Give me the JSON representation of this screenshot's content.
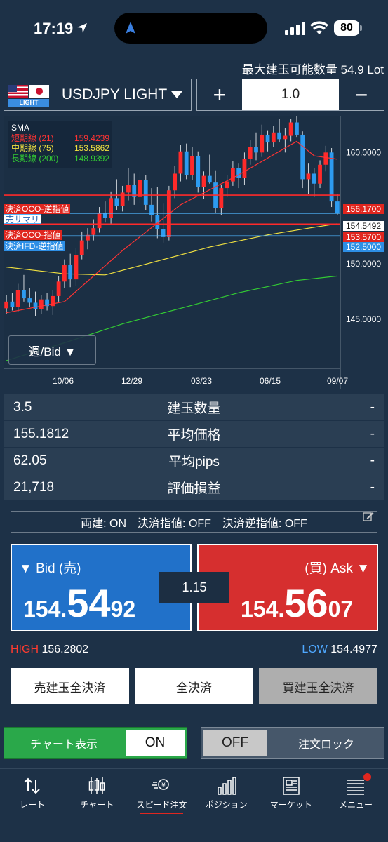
{
  "status_bar": {
    "time": "17:19",
    "battery": "80"
  },
  "header": {
    "max_qty": "最大建玉可能数量 54.9 Lot"
  },
  "symbol": {
    "name": "USDJPY LIGHT",
    "tag": "LIGHT"
  },
  "quantity": {
    "plus": "+",
    "value": "1.0",
    "minus": "−"
  },
  "chart": {
    "sma": {
      "title": "SMA",
      "rows": [
        {
          "label": "短期線 (21)",
          "value": "159.4239",
          "color": "#ff3333"
        },
        {
          "label": "中期線 (75)",
          "value": "153.5862",
          "color": "#f0e040"
        },
        {
          "label": "長期線 (200)",
          "value": "148.9392",
          "color": "#33cc33"
        }
      ]
    },
    "timeframe_button": "週/Bid ▼",
    "order_labels": {
      "oco_stop": "決済OCO-逆指値",
      "sell_summary": "売サマリ",
      "oco_limit": "決済OCO-指値",
      "ifd_stop": "決済IFD-逆指値"
    },
    "price_tags": {
      "oco_stop": "156.1700",
      "current": "154.5492",
      "oco_limit": "153.5700",
      "ifd_stop": "152.5000"
    }
  },
  "chart_data": {
    "type": "candlestick",
    "y_ticks": [
      "160.0000",
      "155.0000",
      "150.0000",
      "145.0000"
    ],
    "x_ticks": [
      "10/06",
      "12/29",
      "03/23",
      "06/15",
      "09/07"
    ],
    "ylim": [
      140.6,
      163.3
    ],
    "candles": [
      {
        "o": 146.0,
        "h": 147.2,
        "l": 145.5,
        "c": 146.6
      },
      {
        "o": 146.6,
        "h": 147.4,
        "l": 145.8,
        "c": 146.1
      },
      {
        "o": 146.1,
        "h": 148.2,
        "l": 145.7,
        "c": 147.6
      },
      {
        "o": 147.6,
        "h": 149.0,
        "l": 146.6,
        "c": 146.9
      },
      {
        "o": 146.9,
        "h": 147.8,
        "l": 146.1,
        "c": 146.5
      },
      {
        "o": 146.5,
        "h": 147.5,
        "l": 145.3,
        "c": 145.9
      },
      {
        "o": 145.9,
        "h": 147.2,
        "l": 145.5,
        "c": 146.8
      },
      {
        "o": 146.8,
        "h": 147.4,
        "l": 145.8,
        "c": 146.2
      },
      {
        "o": 146.2,
        "h": 147.6,
        "l": 145.4,
        "c": 147.1
      },
      {
        "o": 147.1,
        "h": 148.9,
        "l": 146.6,
        "c": 148.4
      },
      {
        "o": 148.4,
        "h": 150.4,
        "l": 147.8,
        "c": 149.9
      },
      {
        "o": 149.9,
        "h": 150.9,
        "l": 147.9,
        "c": 148.6
      },
      {
        "o": 148.6,
        "h": 151.4,
        "l": 148.0,
        "c": 150.8
      },
      {
        "o": 150.8,
        "h": 152.9,
        "l": 150.4,
        "c": 152.1
      },
      {
        "o": 152.1,
        "h": 153.2,
        "l": 151.3,
        "c": 152.6
      },
      {
        "o": 152.6,
        "h": 154.0,
        "l": 152.1,
        "c": 153.2
      },
      {
        "o": 153.2,
        "h": 155.1,
        "l": 152.8,
        "c": 154.6
      },
      {
        "o": 154.6,
        "h": 155.6,
        "l": 153.7,
        "c": 154.1
      },
      {
        "o": 154.1,
        "h": 156.5,
        "l": 153.5,
        "c": 155.9
      },
      {
        "o": 155.9,
        "h": 157.6,
        "l": 154.8,
        "c": 155.2
      },
      {
        "o": 155.2,
        "h": 157.0,
        "l": 154.7,
        "c": 156.4
      },
      {
        "o": 156.4,
        "h": 158.6,
        "l": 155.7,
        "c": 157.1
      },
      {
        "o": 157.1,
        "h": 158.1,
        "l": 155.3,
        "c": 156.0
      },
      {
        "o": 156.0,
        "h": 158.3,
        "l": 155.4,
        "c": 157.5
      },
      {
        "o": 157.5,
        "h": 158.0,
        "l": 154.8,
        "c": 155.3
      },
      {
        "o": 155.3,
        "h": 156.8,
        "l": 153.8,
        "c": 154.4
      },
      {
        "o": 154.4,
        "h": 156.9,
        "l": 152.3,
        "c": 153.1
      },
      {
        "o": 153.1,
        "h": 155.4,
        "l": 151.9,
        "c": 152.4
      },
      {
        "o": 152.4,
        "h": 157.0,
        "l": 152.1,
        "c": 156.6
      },
      {
        "o": 156.6,
        "h": 158.8,
        "l": 155.9,
        "c": 158.1
      },
      {
        "o": 158.1,
        "h": 160.7,
        "l": 157.4,
        "c": 160.1
      },
      {
        "o": 160.1,
        "h": 160.8,
        "l": 157.6,
        "c": 158.0
      },
      {
        "o": 158.0,
        "h": 160.5,
        "l": 157.5,
        "c": 159.7
      },
      {
        "o": 159.7,
        "h": 160.1,
        "l": 156.4,
        "c": 156.9
      },
      {
        "o": 156.9,
        "h": 158.3,
        "l": 155.8,
        "c": 157.9
      },
      {
        "o": 157.9,
        "h": 159.8,
        "l": 157.2,
        "c": 157.3
      },
      {
        "o": 157.3,
        "h": 158.4,
        "l": 154.6,
        "c": 155.0
      },
      {
        "o": 155.0,
        "h": 157.1,
        "l": 154.4,
        "c": 156.8
      },
      {
        "o": 156.8,
        "h": 158.0,
        "l": 156.0,
        "c": 157.4
      },
      {
        "o": 157.4,
        "h": 159.2,
        "l": 157.0,
        "c": 158.6
      },
      {
        "o": 158.6,
        "h": 159.0,
        "l": 156.8,
        "c": 157.7
      },
      {
        "o": 157.7,
        "h": 160.0,
        "l": 157.1,
        "c": 159.4
      },
      {
        "o": 159.4,
        "h": 161.1,
        "l": 158.9,
        "c": 160.5
      },
      {
        "o": 160.5,
        "h": 161.8,
        "l": 159.3,
        "c": 160.0
      },
      {
        "o": 160.0,
        "h": 162.5,
        "l": 159.6,
        "c": 161.6
      },
      {
        "o": 161.6,
        "h": 162.0,
        "l": 160.1,
        "c": 160.9
      },
      {
        "o": 160.9,
        "h": 162.4,
        "l": 160.5,
        "c": 161.8
      },
      {
        "o": 161.8,
        "h": 163.0,
        "l": 160.9,
        "c": 161.2
      },
      {
        "o": 161.2,
        "h": 162.2,
        "l": 160.0,
        "c": 161.5
      },
      {
        "o": 161.5,
        "h": 163.0,
        "l": 161.0,
        "c": 162.7
      },
      {
        "o": 162.7,
        "h": 163.3,
        "l": 161.4,
        "c": 161.6
      },
      {
        "o": 161.6,
        "h": 161.9,
        "l": 156.8,
        "c": 157.6
      },
      {
        "o": 157.6,
        "h": 159.0,
        "l": 156.3,
        "c": 158.1
      },
      {
        "o": 158.1,
        "h": 158.6,
        "l": 156.0,
        "c": 157.2
      },
      {
        "o": 157.2,
        "h": 159.3,
        "l": 156.8,
        "c": 158.9
      },
      {
        "o": 158.9,
        "h": 160.6,
        "l": 158.3,
        "c": 160.0
      },
      {
        "o": 160.0,
        "h": 160.4,
        "l": 155.1,
        "c": 155.6
      },
      {
        "o": 155.6,
        "h": 156.3,
        "l": 154.4,
        "c": 154.5
      }
    ],
    "sma_short": [
      [
        0,
        145.6
      ],
      [
        10,
        146.6
      ],
      [
        20,
        151.2
      ],
      [
        30,
        155.3
      ],
      [
        40,
        158.0
      ],
      [
        50,
        161.0
      ],
      [
        53,
        159.7
      ],
      [
        57,
        159.4
      ]
    ],
    "sma_mid": [
      [
        0,
        149.7
      ],
      [
        10,
        149.1
      ],
      [
        17,
        149.0
      ],
      [
        25,
        150.1
      ],
      [
        35,
        151.5
      ],
      [
        45,
        152.6
      ],
      [
        52,
        153.2
      ],
      [
        57,
        153.6
      ]
    ],
    "sma_long": [
      [
        0,
        141.3
      ],
      [
        10,
        142.9
      ],
      [
        20,
        144.6
      ],
      [
        30,
        146.0
      ],
      [
        40,
        147.4
      ],
      [
        50,
        148.5
      ],
      [
        57,
        148.9
      ]
    ],
    "hlines": [
      {
        "name": "決済OCO-逆指値",
        "value": 156.17,
        "color": "#ff2a2a"
      },
      {
        "name": "売サマリ",
        "value": 154.5492,
        "color": "#4fb7ff"
      },
      {
        "name": "決済OCO-指値",
        "value": 153.57,
        "color": "#ff2a2a"
      },
      {
        "name": "決済IFD-逆指値",
        "value": 152.5,
        "color": "#4fb7ff"
      }
    ]
  },
  "positions": [
    {
      "value": "3.5",
      "label": "建玉数量",
      "dash": "-"
    },
    {
      "value": "155.1812",
      "label": "平均価格",
      "dash": "-"
    },
    {
      "value": "62.05",
      "label": "平均pips",
      "dash": "-"
    },
    {
      "value": "21,718",
      "label": "評価損益",
      "dash": "-"
    }
  ],
  "settings": {
    "text": "両建: ON　決済指値: OFF　決済逆指値: OFF"
  },
  "bid": {
    "label": "▼ Bid (売)",
    "p1": "154.",
    "p2": "54",
    "p3": "92"
  },
  "ask": {
    "label": "(買) Ask ▼",
    "p1": "154.",
    "p2": "56",
    "p3": "07"
  },
  "spread": "1.15",
  "high": {
    "label": "HIGH",
    "value": "156.2802"
  },
  "low": {
    "label": "LOW",
    "value": "154.4977"
  },
  "buttons": {
    "sell_close_all": "売建玉全決済",
    "close_all": "全決済",
    "buy_close_all": "買建玉全決済"
  },
  "toggles": {
    "chart_label": "チャート表示",
    "chart_value": "ON",
    "lock_value": "OFF",
    "lock_label": "注文ロック"
  },
  "nav": [
    {
      "label": "レート"
    },
    {
      "label": "チャート"
    },
    {
      "label": "スピード注文"
    },
    {
      "label": "ポジション"
    },
    {
      "label": "マーケット"
    },
    {
      "label": "メニュー"
    }
  ],
  "colors": {
    "accent_red": "#e0261f",
    "bid_blue": "#2171c9",
    "ask_red": "#d62f2f",
    "toggle_green": "#2aa84a"
  }
}
